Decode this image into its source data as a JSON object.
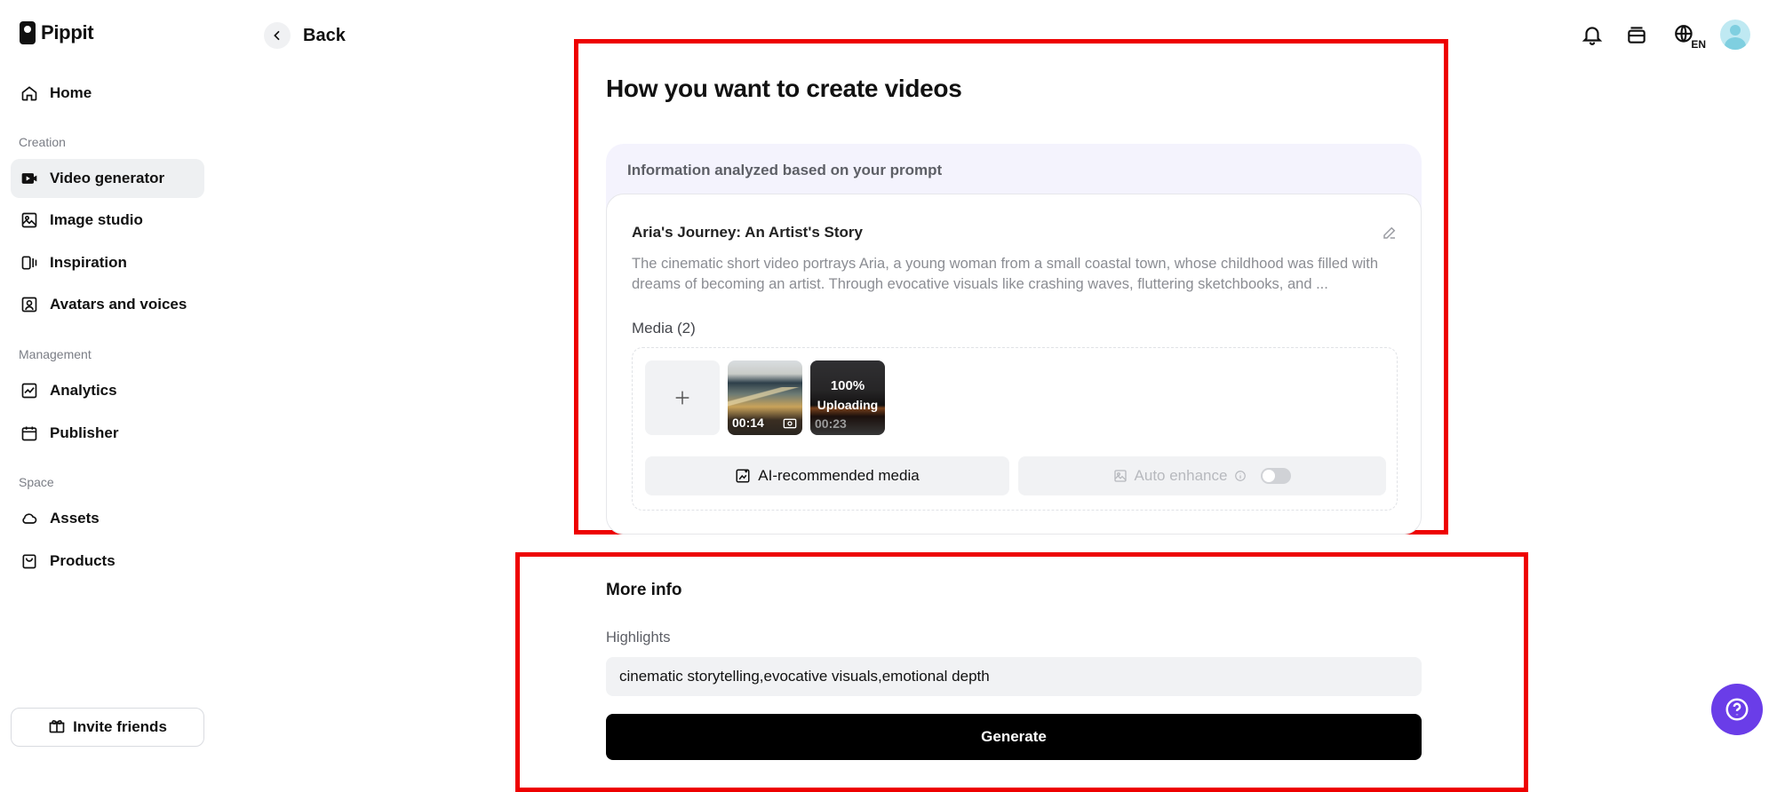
{
  "app": {
    "name": "Pippit"
  },
  "sidebar": {
    "home": "Home",
    "sections": {
      "creation": "Creation",
      "management": "Management",
      "space": "Space"
    },
    "items": {
      "video_generator": "Video generator",
      "image_studio": "Image studio",
      "inspiration": "Inspiration",
      "avatars_voices": "Avatars and voices",
      "analytics": "Analytics",
      "publisher": "Publisher",
      "assets": "Assets",
      "products": "Products"
    },
    "active_item": "Video generator",
    "invite": "Invite friends"
  },
  "header": {
    "back": "Back",
    "language_badge": "EN"
  },
  "main": {
    "title": "How you want to create videos",
    "analysis_label": "Information analyzed based on your prompt",
    "story": {
      "title": "Aria's Journey: An Artist's Story",
      "description": "The cinematic short video portrays Aria, a young woman from a small coastal town, whose childhood was filled with dreams of becoming an artist. Through evocative visuals like crashing waves, fluttering sketchbooks, and ..."
    },
    "media": {
      "label": "Media (2)",
      "items": [
        {
          "duration": "00:14"
        },
        {
          "progress_label": "100%",
          "status": "Uploading",
          "duration": "00:23"
        }
      ],
      "ai_button": "AI-recommended media",
      "auto_enhance": "Auto enhance",
      "auto_enhance_enabled": false
    }
  },
  "more_info": {
    "title": "More info",
    "highlights_label": "Highlights",
    "highlights_value": "cinematic storytelling,evocative visuals,emotional depth",
    "generate_button": "Generate"
  },
  "colors": {
    "accent_red": "#ee0000",
    "help_purple": "#6a3de8",
    "analysis_bg": "#f4f3fd"
  }
}
